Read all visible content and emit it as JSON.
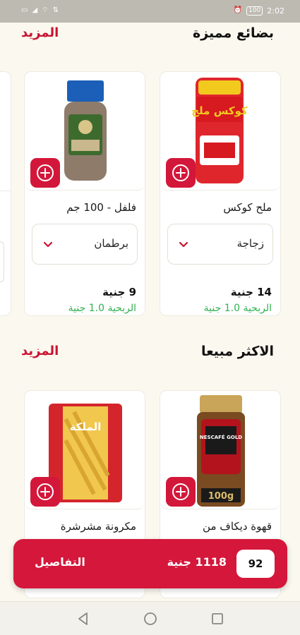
{
  "status_bar": {
    "time": "2:02",
    "battery": "100"
  },
  "sections": {
    "featured": {
      "title": "بضائع مميزة",
      "more": "المزيد"
    },
    "best_sellers": {
      "title": "الاكثر مبيعا",
      "more": "المزيد"
    }
  },
  "featured_products": [
    {
      "name": "ملح كوكس",
      "unit": "زجاجة",
      "price": "14 جنية",
      "profit": "الربحية 1.0 جنية",
      "image_label": "كوكس ملح",
      "image": "salt-bottle"
    },
    {
      "name": "فلفل - 100 جم",
      "unit": "برطمان",
      "price": "9 جنية",
      "profit": "الربحية 1.0 جنية",
      "image_label": "",
      "image": "pepper-jar"
    }
  ],
  "best_products": [
    {
      "name": "قهوة ديكاف من",
      "image_label": "NESCAFÉ GOLD",
      "image_weight": "100g",
      "image": "coffee-jar"
    },
    {
      "name": "مكرونة مشرشرة",
      "image_label": "الملكة",
      "image": "pasta-bag"
    }
  ],
  "cart": {
    "count": "92",
    "total": "1118 جنية",
    "details": "التفاصيل"
  },
  "colors": {
    "accent": "#d4173b",
    "profit": "#2eb14f",
    "background": "#fbf8ef"
  },
  "icons": [
    "wifi-icon",
    "signal-icon",
    "alarm-icon",
    "battery-icon",
    "plus-circle-icon",
    "chevron-down-icon",
    "back-icon",
    "home-icon",
    "recents-icon"
  ]
}
